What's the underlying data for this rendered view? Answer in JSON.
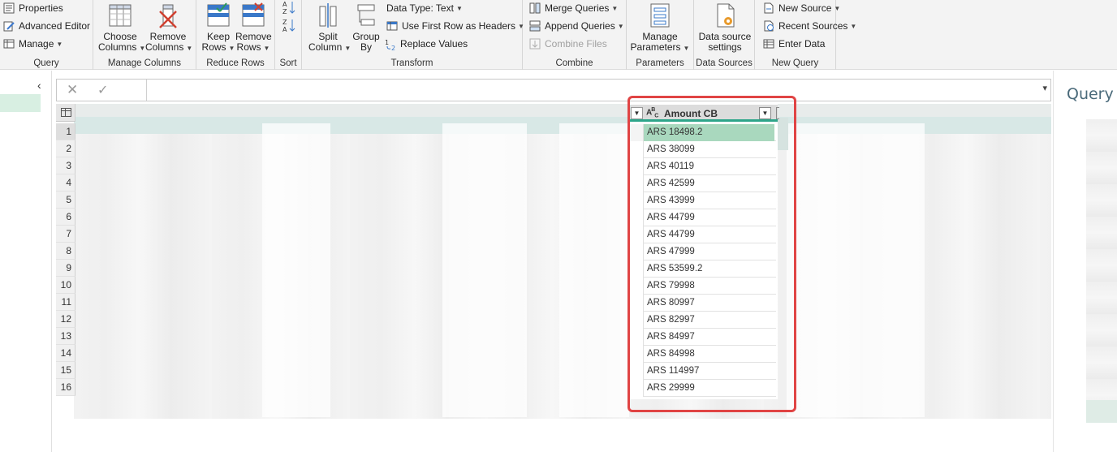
{
  "ribbon": {
    "query_group": {
      "label": "Query",
      "properties": "Properties",
      "advanced_editor": "Advanced Editor",
      "manage": "Manage"
    },
    "manage_columns": {
      "label": "Manage Columns",
      "choose_columns": "Choose\nColumns",
      "remove_columns": "Remove\nColumns"
    },
    "reduce_rows": {
      "label": "Reduce Rows",
      "keep_rows": "Keep\nRows",
      "remove_rows": "Remove\nRows"
    },
    "sort": {
      "label": "Sort"
    },
    "transform": {
      "label": "Transform",
      "split_column": "Split\nColumn",
      "group_by": "Group\nBy",
      "data_type": "Data Type: Text",
      "use_first_row": "Use First Row as Headers",
      "replace_values": "Replace Values"
    },
    "combine": {
      "label": "Combine",
      "merge_queries": "Merge Queries",
      "append_queries": "Append Queries",
      "combine_files": "Combine Files"
    },
    "parameters": {
      "label": "Parameters",
      "manage_parameters": "Manage\nParameters"
    },
    "data_sources": {
      "label": "Data Sources",
      "data_source_settings": "Data source\nsettings"
    },
    "new_query": {
      "label": "New Query",
      "new_source": "New Source",
      "recent_sources": "Recent Sources",
      "enter_data": "Enter Data"
    }
  },
  "right_panel": {
    "title": "Query S"
  },
  "grid": {
    "row_numbers": [
      "1",
      "2",
      "3",
      "4",
      "5",
      "6",
      "7",
      "8",
      "9",
      "10",
      "11",
      "12",
      "13",
      "14",
      "15",
      "16"
    ],
    "selected_row": "1",
    "column": {
      "type_icon": "ABC",
      "header": "Amount CB",
      "values": [
        "ARS 18498.2",
        "ARS 38099",
        "ARS 40119",
        "ARS 42599",
        "ARS 43999",
        "ARS 44799",
        "ARS 44799",
        "ARS 47999",
        "ARS 53599.2",
        "ARS 79998",
        "ARS 80997",
        "ARS 82997",
        "ARS 84997",
        "ARS 84998",
        "ARS 114997",
        "ARS 29999"
      ]
    }
  },
  "colors": {
    "highlight_border": "#e04444",
    "column_accent": "#2ea58a",
    "selected_cell": "#a9d8be"
  }
}
